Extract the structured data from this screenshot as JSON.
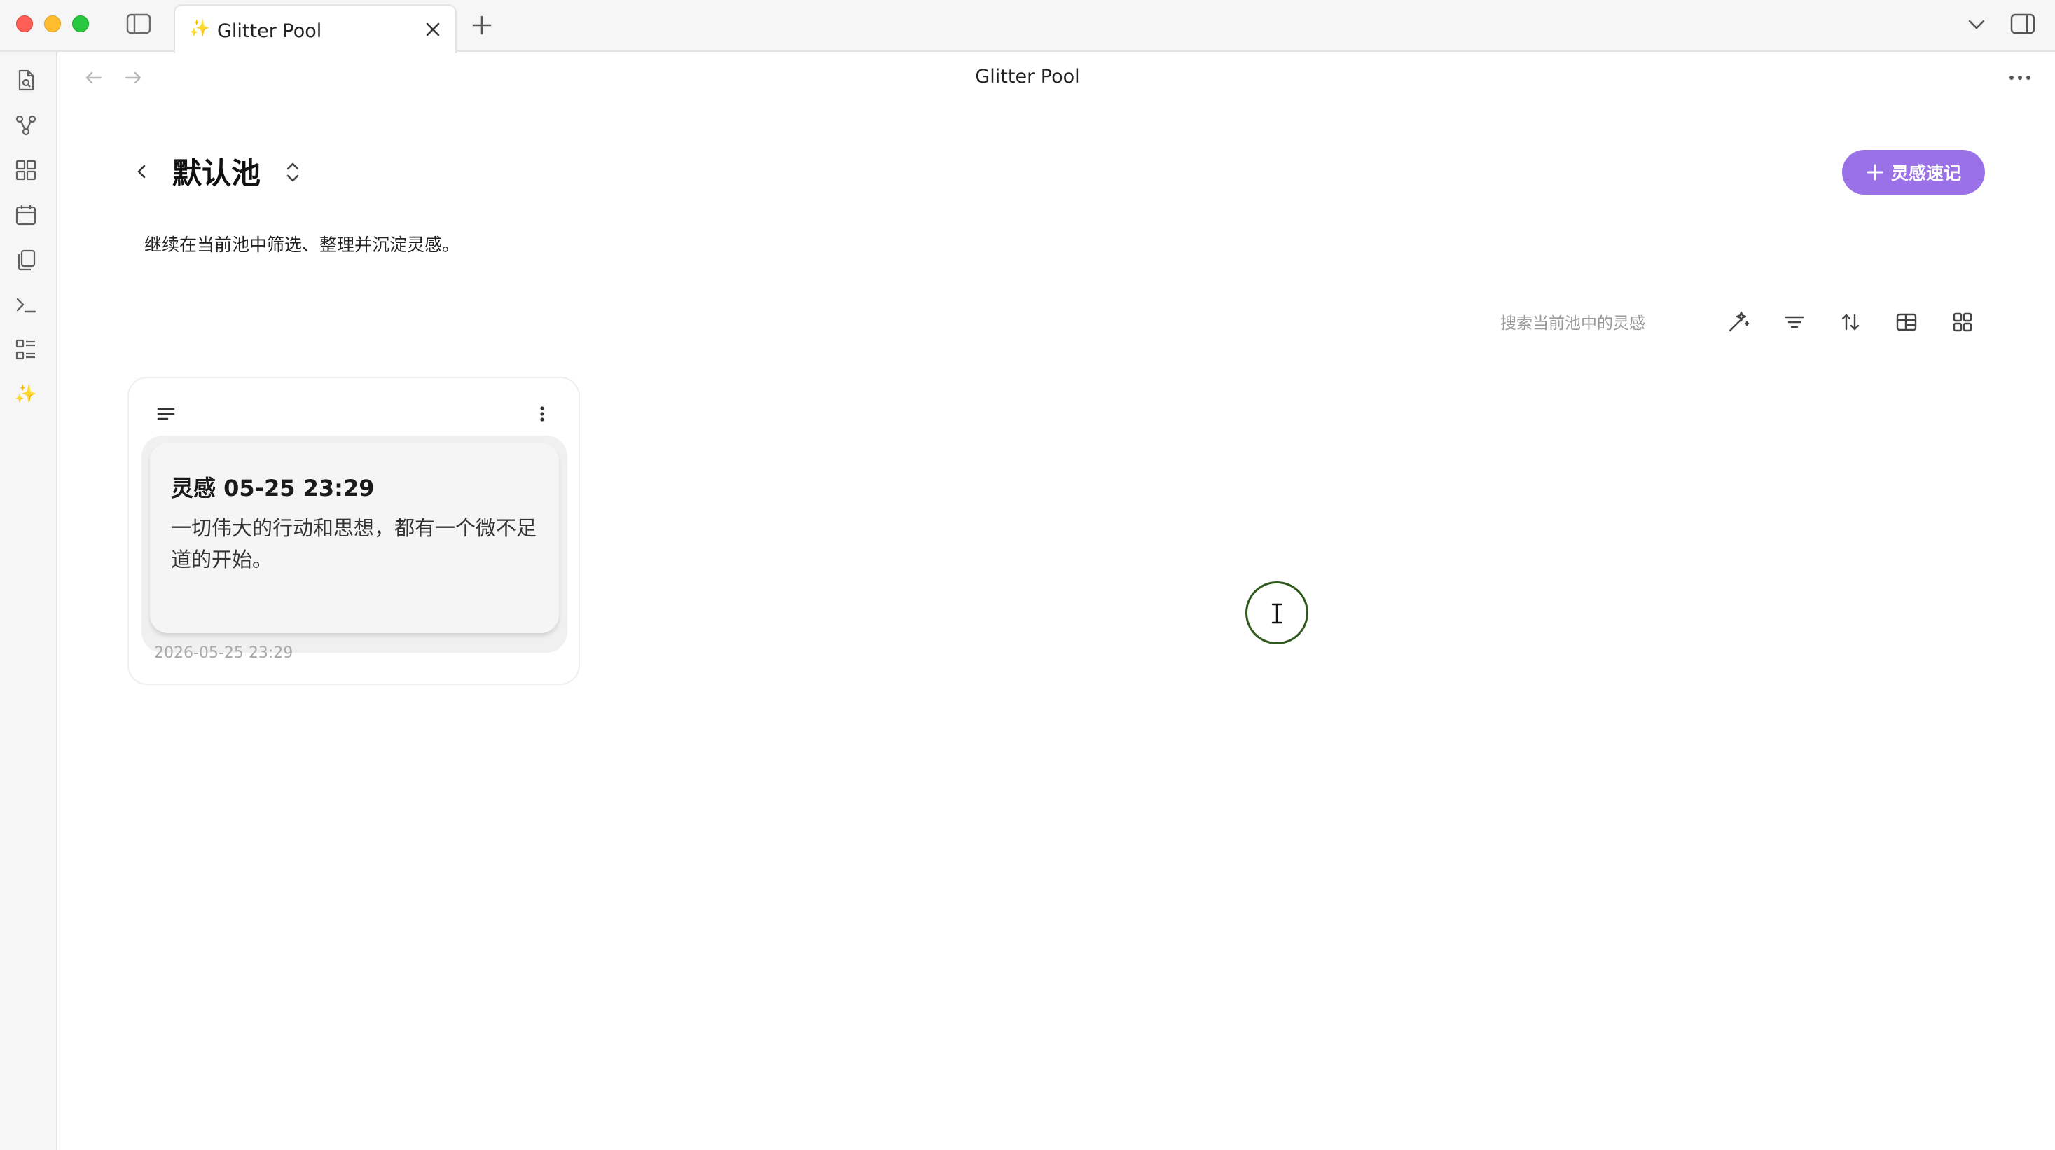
{
  "window": {
    "tab_title": "Glitter Pool",
    "tab_icon": "sparkle-icon",
    "view_title": "Glitter Pool"
  },
  "ribbon": {
    "items": [
      {
        "icon": "file-search-icon"
      },
      {
        "icon": "graph-icon"
      },
      {
        "icon": "grid-icon"
      },
      {
        "icon": "calendar-icon"
      },
      {
        "icon": "copy-icon"
      },
      {
        "icon": "terminal-icon"
      },
      {
        "icon": "list-icon"
      },
      {
        "icon": "sparkle-icon"
      }
    ]
  },
  "pool": {
    "name": "默认池",
    "description": "继续在当前池中筛选、整理并沉淀灵感。",
    "add_button_label": "灵感速记"
  },
  "toolbar": {
    "search_placeholder": "搜索当前池中的灵感",
    "tools": [
      "magic-icon",
      "filter-icon",
      "sort-icon",
      "layout-table-icon",
      "layout-grid-icon"
    ]
  },
  "cards": [
    {
      "title": "灵感 05-25 23:29",
      "body": "一切伟大的行动和思想，都有一个微不足道的开始。",
      "created": "2026-05-25 23:29"
    }
  ],
  "colors": {
    "accent": "#9b71e8",
    "tab_star": "#f2c200",
    "cursor_ring": "#2e5a1c"
  }
}
